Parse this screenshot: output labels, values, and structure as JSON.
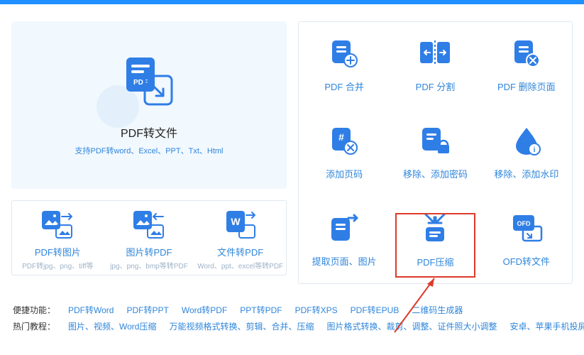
{
  "hero": {
    "title": "PDF转文件",
    "subtitle": "支持PDF转word、Excel、PPT、Txt、Html"
  },
  "small_tools": [
    {
      "name": "PDF转图片",
      "desc": "PDF转jpg、png、tiff等"
    },
    {
      "name": "图片转PDF",
      "desc": "jpg、png、bmp等转PDF"
    },
    {
      "name": "文件转PDF",
      "desc": "Word、ppt、excel等转PDF"
    }
  ],
  "big_tools": [
    {
      "name": "PDF 合并"
    },
    {
      "name": "PDF 分割"
    },
    {
      "name": "PDF 删除页面"
    },
    {
      "name": "添加页码"
    },
    {
      "name": "移除、添加密码"
    },
    {
      "name": "移除、添加水印"
    },
    {
      "name": "提取页面、图片"
    },
    {
      "name": "PDF压缩",
      "highlight": true
    },
    {
      "name": "OFD转文件"
    }
  ],
  "quick_links": {
    "label": "便捷功能：",
    "items": [
      "PDF转Word",
      "PDF转PPT",
      "Word转PDF",
      "PPT转PDF",
      "PDF转XPS",
      "PDF转EPUB",
      "二维码生成器"
    ]
  },
  "hot_links": {
    "label": "热门教程：",
    "items": [
      "图片、视频、Word压缩",
      "万能视频格式转换、剪辑、合并、压缩",
      "图片格式转换、裁剪、调整、证件照大小调整",
      "安卓、苹果手机投屏至"
    ]
  }
}
